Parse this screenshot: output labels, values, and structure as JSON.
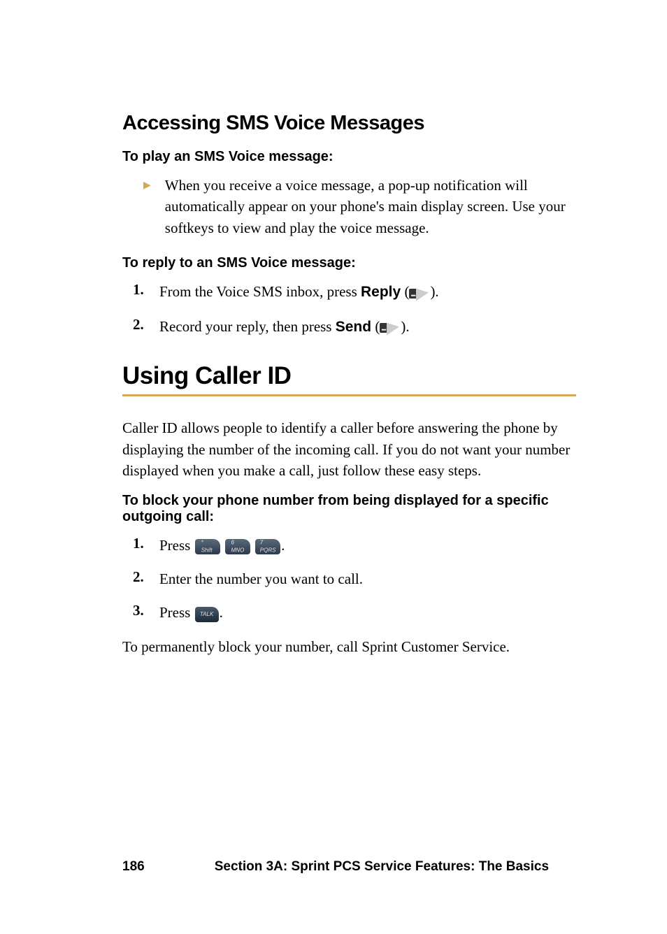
{
  "section1": {
    "heading": "Accessing SMS Voice Messages",
    "play": {
      "label": "To play an SMS Voice message:",
      "bullet": "When you receive a voice message, a pop-up notification will automatically appear on your phone's main display screen. Use your softkeys to view and play the voice message."
    },
    "reply": {
      "label": "To reply to an SMS Voice message:",
      "items": [
        {
          "num": "1.",
          "pre": "From the Voice SMS inbox, press ",
          "bold": "Reply",
          "post_open": " (",
          "post_close": ")."
        },
        {
          "num": "2.",
          "pre": "Record your reply, then press ",
          "bold": "Send",
          "post_open": " (",
          "post_close": ")."
        }
      ]
    }
  },
  "section2": {
    "heading": "Using Caller ID",
    "intro": "Caller ID allows people to identify a caller before answering the phone by displaying the number of the incoming call. If you do not want your number displayed when you make a call, just follow these easy steps.",
    "block_label": "To block your phone number from being displayed for a specific outgoing call:",
    "steps": {
      "s1": {
        "num": "1.",
        "pre": "Press ",
        "post": "."
      },
      "s2": {
        "num": "2.",
        "text": "Enter the number you want to call."
      },
      "s3": {
        "num": "3.",
        "pre": "Press ",
        "post": "."
      }
    },
    "outro": "To permanently block your number, call Sprint Customer Service."
  },
  "keys": {
    "star": "* Shift",
    "six": "6 MNO",
    "seven": "7 PQRS",
    "talk": "TALK"
  },
  "footer": {
    "page": "186",
    "title": "Section 3A: Sprint PCS Service Features: The Basics"
  }
}
